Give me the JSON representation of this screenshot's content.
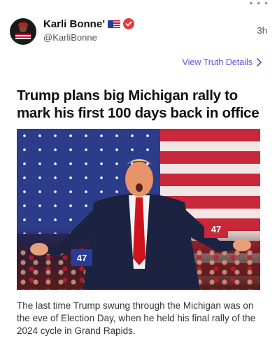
{
  "post": {
    "display_name": "Karli Bonne’",
    "handle": "@KarliBonne",
    "timestamp": "3h",
    "flag_icon": "us-flag-icon",
    "badge_icon": "verified-badge-icon",
    "badge_color": "#e53a3a",
    "avatar_text": "BANDIT SAYS"
  },
  "details_link": {
    "label": "View Truth Details",
    "color": "#5b52d6"
  },
  "article": {
    "headline": "Trump plans big Michigan rally to mark his first 100 days back in office",
    "caption": "The last time Trump swung through the Michigan was on the eve of Election Day, when he held his final rally of the 2024 cycle in Grand Rapids.",
    "image_sign_numbers": [
      "47",
      "47"
    ]
  }
}
